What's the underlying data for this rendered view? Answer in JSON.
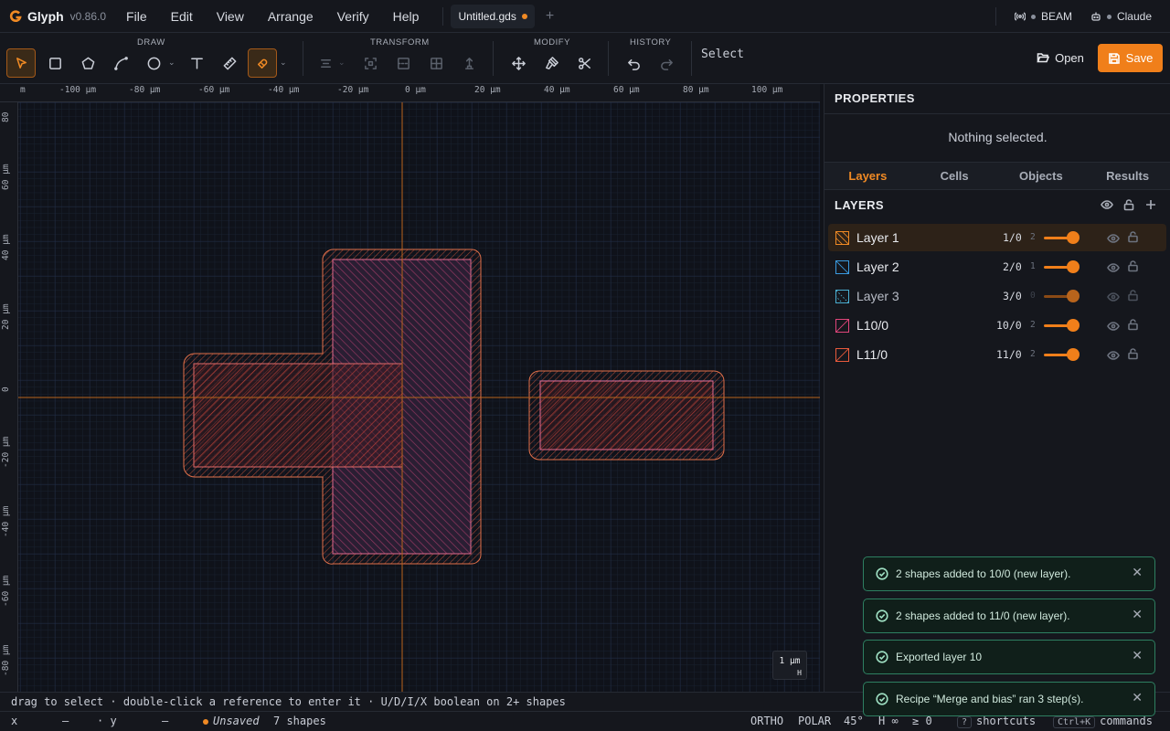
{
  "app": {
    "name": "Glyph",
    "version": "v0.86.0"
  },
  "menu": [
    "File",
    "Edit",
    "View",
    "Arrange",
    "Verify",
    "Help"
  ],
  "document_tab": {
    "title": "Untitled.gds"
  },
  "status_right": {
    "beam": "BEAM",
    "claude": "Claude"
  },
  "toolbar": {
    "groups": {
      "draw": "DRAW",
      "transform": "TRANSFORM",
      "modify": "MODIFY",
      "history": "HISTORY"
    },
    "mode_label": "Select",
    "open_label": "Open",
    "save_label": "Save",
    "icons": [
      "select-arrow-icon",
      "rectangle-icon",
      "polygon-icon",
      "path-icon",
      "circle-icon",
      "text-icon",
      "ruler-icon",
      "snap-magnet-icon",
      "align-icon",
      "group-icon",
      "ungroup-icon",
      "array-icon",
      "stack-icon",
      "move-icon",
      "paint-icon",
      "cut-icon",
      "undo-icon",
      "redo-icon"
    ]
  },
  "rulers": {
    "top": [
      "m",
      "-100 µm",
      "-80 µm",
      "-60 µm",
      "-40 µm",
      "-20 µm",
      "0 µm",
      "20 µm",
      "40 µm",
      "60 µm",
      "80 µm",
      "100 µm"
    ],
    "left": [
      "80",
      "60 µm",
      "40 µm",
      "20 µm",
      "0",
      "-20 µm",
      "-40 µm",
      "-60 µm",
      "-80 µm"
    ]
  },
  "scale_badge": {
    "value": "1 µm",
    "mode": "H"
  },
  "properties": {
    "title": "PROPERTIES",
    "empty_text": "Nothing selected."
  },
  "panel_tabs": [
    "Layers",
    "Cells",
    "Objects",
    "Results"
  ],
  "layers": {
    "title": "LAYERS",
    "items": [
      {
        "name": "Layer 1",
        "num": "1/0",
        "opacity": "2",
        "color": "#f08a24"
      },
      {
        "name": "Layer 2",
        "num": "2/0",
        "opacity": "1",
        "color": "#3a9be0"
      },
      {
        "name": "Layer 3",
        "num": "3/0",
        "opacity": "0",
        "color": "#4aaed0"
      },
      {
        "name": "L10/0",
        "num": "10/0",
        "opacity": "2",
        "color": "#e0457a"
      },
      {
        "name": "L11/0",
        "num": "11/0",
        "opacity": "2",
        "color": "#e85a3c"
      }
    ]
  },
  "toasts": [
    "2 shapes added to 10/0 (new layer).",
    "2 shapes added to 11/0 (new layer).",
    "Exported layer 10",
    "Recipe “Merge and bias” ran 3 step(s)."
  ],
  "hint": "drag to select · double-click a reference to enter it · U/D/I/X boolean on 2+ shapes",
  "statusbar": {
    "x_label": "x",
    "x_value": "—",
    "y_label": "· y",
    "y_value": "—",
    "unsaved": "Unsaved",
    "shapes": "7 shapes",
    "ortho": "ORTHO",
    "polar": "POLAR",
    "angle": "45°",
    "h": "H ∞",
    "ge": "≥ 0",
    "shortcuts_key": "?",
    "shortcuts": "shortcuts",
    "commands_key": "Ctrl+K",
    "commands": "commands"
  }
}
